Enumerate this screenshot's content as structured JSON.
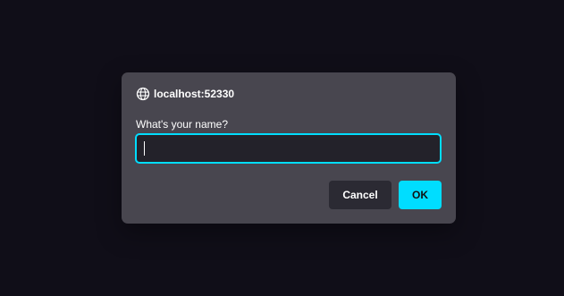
{
  "dialog": {
    "origin": "localhost:52330",
    "origin_icon": "globe-icon",
    "message": "What's your name?",
    "input": {
      "value": "",
      "placeholder": ""
    },
    "buttons": {
      "cancel": "Cancel",
      "ok": "OK"
    }
  },
  "colors": {
    "background": "#100e18",
    "dialog": "#48464f",
    "input_background": "#23222a",
    "focus_accent": "#00ddff",
    "cancel_button": "#2b2a33",
    "ok_button": "#00ddff",
    "text": "#ffffff"
  }
}
